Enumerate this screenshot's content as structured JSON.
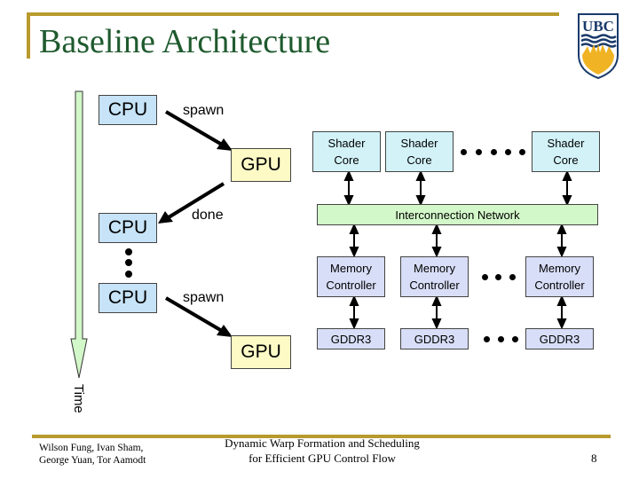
{
  "slide": {
    "title": "Baseline Architecture",
    "logo_text": "UBC",
    "colors": {
      "title": "#1f5a2e",
      "rule": "#b89a2e",
      "cpu": "#c6e3f7",
      "gpu": "#fdfac6",
      "shader": "#d2f2f8",
      "network": "#d2f7c8",
      "memory": "#d8def7",
      "timeline": "#d2f7c8"
    }
  },
  "timeline": {
    "label": "Time",
    "cpu_boxes": [
      "CPU",
      "CPU",
      "CPU"
    ],
    "gpu_boxes": [
      "GPU",
      "GPU"
    ],
    "arrow_labels": [
      "spawn",
      "done",
      "spawn"
    ]
  },
  "architecture": {
    "shader_cores": [
      {
        "line1": "Shader",
        "line2": "Core"
      },
      {
        "line1": "Shader",
        "line2": "Core"
      },
      {
        "line1": "Shader",
        "line2": "Core"
      }
    ],
    "interconnect": "Interconnection Network",
    "memory_controllers": [
      {
        "line1": "Memory",
        "line2": "Controller"
      },
      {
        "line1": "Memory",
        "line2": "Controller"
      },
      {
        "line1": "Memory",
        "line2": "Controller"
      }
    ],
    "dram": [
      "GDDR3",
      "GDDR3",
      "GDDR3"
    ]
  },
  "footer": {
    "authors_line1": "Wilson Fung, Ivan Sham,",
    "authors_line2": "George Yuan, Tor Aamodt",
    "talk_line1": "Dynamic Warp Formation and Scheduling",
    "talk_line2": "for Efficient GPU Control Flow",
    "page_number": "8"
  }
}
